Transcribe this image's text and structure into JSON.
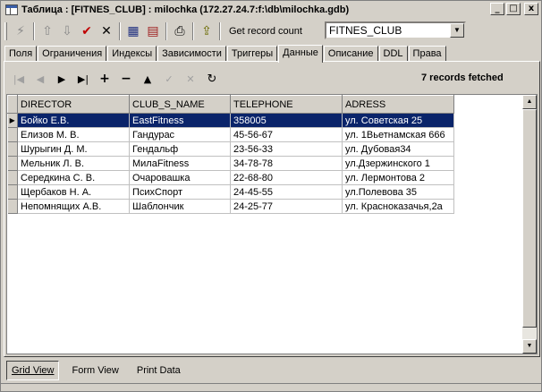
{
  "window": {
    "title": "Таблица : [FITNES_CLUB] : milochka (172.27.24.7:f:\\db\\milochka.gdb)",
    "buttons": {
      "minimize": "_",
      "maximize": "□",
      "close": "x"
    }
  },
  "toolbar": {
    "get_record_count": "Get record count",
    "table_select": "FITNES_CLUB"
  },
  "tabs": [
    {
      "label": "Поля",
      "active": false
    },
    {
      "label": "Ограничения",
      "active": false
    },
    {
      "label": "Индексы",
      "active": false
    },
    {
      "label": "Зависимости",
      "active": false
    },
    {
      "label": "Триггеры",
      "active": false
    },
    {
      "label": "Данные",
      "active": true
    },
    {
      "label": "Описание",
      "active": false
    },
    {
      "label": "DDL",
      "active": false
    },
    {
      "label": "Права",
      "active": false
    }
  ],
  "status": {
    "fetched": "7 records fetched"
  },
  "grid": {
    "columns": [
      "DIRECTOR",
      "CLUB_S_NAME",
      "TELEPHONE",
      "ADRESS"
    ],
    "rows": [
      [
        "Бойко Е.В.",
        "EastFitness",
        "358005",
        "ул. Советская 25"
      ],
      [
        "Елизов М. В.",
        "Гандурас",
        "45-56-67",
        "ул. 1Вьетнамская 666"
      ],
      [
        "Шурыгин Д. М.",
        "Гендальф",
        "23-56-33",
        "ул. Дубовая34"
      ],
      [
        "Мельник Л. В.",
        "МилаFitness",
        "34-78-78",
        "ул.Дзержинского 1"
      ],
      [
        "Середкина С. В.",
        "Очаровашка",
        "22-68-80",
        "ул. Лермонтова 2"
      ],
      [
        "Щербаков Н. А.",
        "ПсихСпорт",
        "24-45-55",
        "ул.Полевова 35"
      ],
      [
        "Непомнящих А.В.",
        "Шаблончик",
        "24-25-77",
        "ул. Красноказачья,2а"
      ]
    ],
    "selected_row": 0
  },
  "views": [
    {
      "label": "Grid View",
      "active": true
    },
    {
      "label": "Form View",
      "active": false
    },
    {
      "label": "Print Data",
      "active": false
    }
  ],
  "colors": {
    "selection": "#0a246a",
    "face": "#d4d0c8"
  }
}
